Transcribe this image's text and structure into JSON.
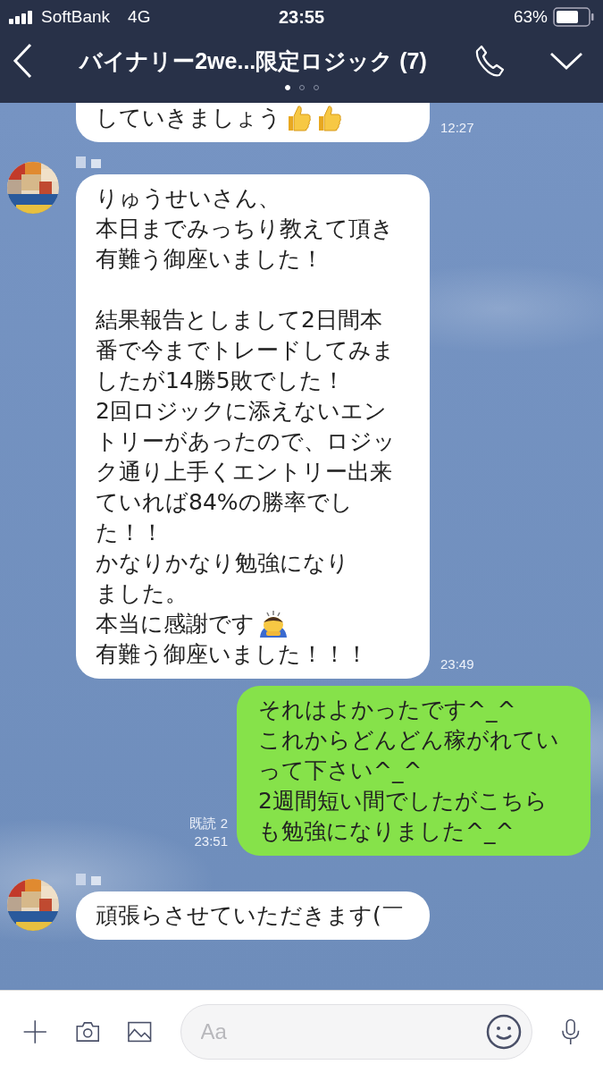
{
  "status_bar": {
    "carrier": "SoftBank",
    "network": "4G",
    "time": "23:55",
    "battery": "63%"
  },
  "header": {
    "title": "バイナリー2we...限定ロジック (7)",
    "pages": [
      {
        "selected": true
      },
      {
        "selected": false
      },
      {
        "selected": false
      }
    ]
  },
  "messages": [
    {
      "kind": "received",
      "avatar": false,
      "paragraphs": [
        [
          {
            "text": "していきましょう",
            "kind": "thumbs_up_pair"
          }
        ]
      ],
      "time": "12:27"
    },
    {
      "kind": "received",
      "avatar": true,
      "paragraphs": [
        [
          {
            "text": "りゅうせいさん、"
          },
          {
            "text": "本日までみっちり教えて頂き"
          },
          {
            "text": "有難う御座いました！"
          }
        ],
        [
          {
            "text": "結果報告としまして2日間本"
          },
          {
            "text": "番で今までトレードしてみま"
          },
          {
            "text": "したが14勝5敗でした！"
          },
          {
            "text": "2回ロジックに添えないエン"
          },
          {
            "text": "トリーがあったので、ロジッ"
          },
          {
            "text": "ク通り上手くエントリー出来"
          },
          {
            "text": "ていれば84%の勝率でし"
          },
          {
            "text": "た！！"
          },
          {
            "text": "かなりかなり勉強になり"
          },
          {
            "text": "ました。"
          },
          {
            "text": "本当に感謝です",
            "kind": "bowing"
          },
          {
            "text": "有難う御座いました！！！"
          }
        ]
      ],
      "time": "23:49"
    },
    {
      "kind": "sent",
      "paragraphs": [
        [
          {
            "text": "それはよかったです^_^"
          },
          {
            "text": "これからどんどん稼がれてい"
          },
          {
            "text": "って下さい^_^"
          },
          {
            "text": "2週間短い間でしたがこちら"
          },
          {
            "text": "も勉強になりました^_^"
          }
        ]
      ],
      "read": "既読 2",
      "time": "23:51"
    },
    {
      "kind": "received",
      "avatar": true,
      "paragraphs": [
        [
          {
            "text": "頑張らさせていただきます(￣"
          }
        ]
      ]
    }
  ],
  "input": {
    "placeholder": "Aa"
  }
}
